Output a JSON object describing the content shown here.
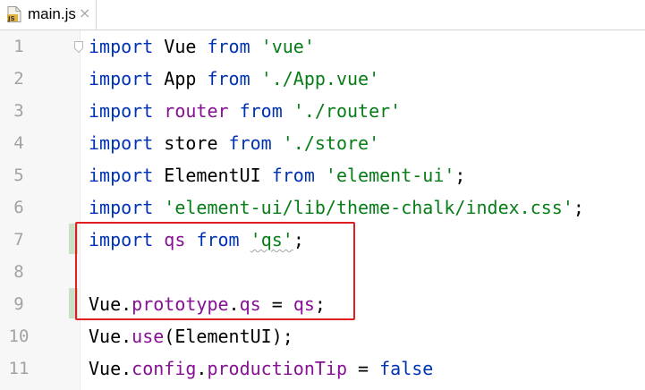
{
  "tab": {
    "file_name": "main.js",
    "close_glyph": "×",
    "icon": "js-file-icon",
    "icon_text": "JS"
  },
  "gutter": {
    "line_numbers": [
      "1",
      "2",
      "3",
      "4",
      "5",
      "6",
      "7",
      "8",
      "9",
      "10",
      "11"
    ]
  },
  "code": {
    "lines": [
      [
        {
          "t": "import",
          "c": "kw"
        },
        {
          "t": " Vue ",
          "c": "plain"
        },
        {
          "t": "from",
          "c": "kw"
        },
        {
          "t": " ",
          "c": "plain"
        },
        {
          "t": "'vue'",
          "c": "str"
        }
      ],
      [
        {
          "t": "import",
          "c": "kw"
        },
        {
          "t": " App ",
          "c": "plain"
        },
        {
          "t": "from",
          "c": "kw"
        },
        {
          "t": " ",
          "c": "plain"
        },
        {
          "t": "'./App.vue'",
          "c": "str"
        }
      ],
      [
        {
          "t": "import",
          "c": "kw"
        },
        {
          "t": " ",
          "c": "plain"
        },
        {
          "t": "router",
          "c": "ident"
        },
        {
          "t": " ",
          "c": "plain"
        },
        {
          "t": "from",
          "c": "kw"
        },
        {
          "t": " ",
          "c": "plain"
        },
        {
          "t": "'./router'",
          "c": "str"
        }
      ],
      [
        {
          "t": "import",
          "c": "kw"
        },
        {
          "t": " store ",
          "c": "plain"
        },
        {
          "t": "from",
          "c": "kw"
        },
        {
          "t": " ",
          "c": "plain"
        },
        {
          "t": "'./store'",
          "c": "str"
        }
      ],
      [
        {
          "t": "import",
          "c": "kw"
        },
        {
          "t": " ElementUI ",
          "c": "plain"
        },
        {
          "t": "from",
          "c": "kw"
        },
        {
          "t": " ",
          "c": "plain"
        },
        {
          "t": "'element-ui'",
          "c": "str"
        },
        {
          "t": ";",
          "c": "plain"
        }
      ],
      [
        {
          "t": "import",
          "c": "kw"
        },
        {
          "t": " ",
          "c": "plain"
        },
        {
          "t": "'element-ui/lib/theme-chalk/index.css'",
          "c": "str"
        },
        {
          "t": ";",
          "c": "plain"
        }
      ],
      [
        {
          "t": "import",
          "c": "kw"
        },
        {
          "t": " ",
          "c": "plain"
        },
        {
          "t": "qs",
          "c": "ident"
        },
        {
          "t": " ",
          "c": "plain"
        },
        {
          "t": "from",
          "c": "kw"
        },
        {
          "t": " ",
          "c": "plain"
        },
        {
          "t": "'qs'",
          "c": "str",
          "squiggle": true
        },
        {
          "t": ";",
          "c": "plain"
        }
      ],
      [],
      [
        {
          "t": "Vue",
          "c": "plain"
        },
        {
          "t": ".",
          "c": "plain"
        },
        {
          "t": "prototype",
          "c": "ident"
        },
        {
          "t": ".",
          "c": "plain"
        },
        {
          "t": "qs",
          "c": "ident"
        },
        {
          "t": " = ",
          "c": "plain"
        },
        {
          "t": "qs",
          "c": "ident"
        },
        {
          "t": ";",
          "c": "plain"
        }
      ],
      [
        {
          "t": "Vue",
          "c": "plain"
        },
        {
          "t": ".",
          "c": "plain"
        },
        {
          "t": "use",
          "c": "ident"
        },
        {
          "t": "(ElementUI);",
          "c": "plain"
        }
      ],
      [
        {
          "t": "Vue",
          "c": "plain"
        },
        {
          "t": ".",
          "c": "plain"
        },
        {
          "t": "config",
          "c": "ident"
        },
        {
          "t": ".",
          "c": "plain"
        },
        {
          "t": "productionTip",
          "c": "ident"
        },
        {
          "t": " = ",
          "c": "plain"
        },
        {
          "t": "false",
          "c": "kw"
        }
      ]
    ]
  },
  "colors": {
    "keyword": "#0033b3",
    "string": "#067d17",
    "identifier": "#871094",
    "highlight_box": "#e02020",
    "change_marker": "#c9dfc6"
  }
}
